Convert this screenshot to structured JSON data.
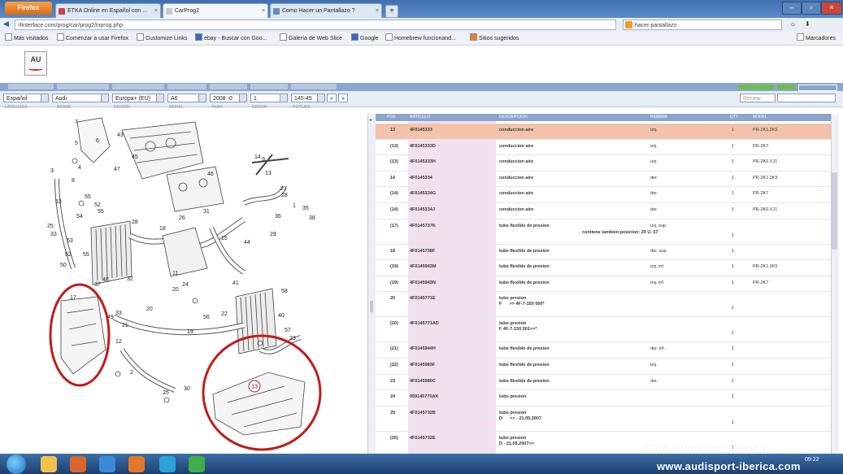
{
  "browser": {
    "firefox_button": "Firefox",
    "tabs": [
      {
        "label": "ETKA Online en Español con ..."
      },
      {
        "label": "CarProg2"
      },
      {
        "label": "Como Hacer un Pantallazo ?"
      }
    ],
    "url": "ifinterface.com/prog/car/prog2/inprog.php",
    "search": "hacer pantallazo",
    "bookmarks": [
      "Más visitados",
      "Comenzar a usar Firefox",
      "Customize Links",
      "ebay - Buscar con Goo...",
      "Galería de Web Slice",
      "Google",
      "Homebrew funcionand...",
      "Sitios sugeridos"
    ],
    "bookmarks_right": "Marcadores"
  },
  "app": {
    "logo_text": "AU",
    "selects": [
      {
        "value": "Español"
      },
      {
        "value": "Audi"
      },
      {
        "value": "Europa+ (EU)"
      },
      {
        "value": "A6"
      },
      {
        "value": "2008 -0"
      },
      {
        "value": "1"
      },
      {
        "value": "145-45"
      }
    ],
    "nav_prev": "«",
    "nav_next": "»",
    "right_field": "Renew",
    "labels": [
      "LANGUAGE",
      "BRAND",
      "REGION",
      "MODEL",
      "YEAR",
      "GROUP",
      "PICTURE"
    ]
  },
  "table": {
    "headers": [
      "POS",
      "ARTICULO",
      "DESCRIPCION",
      "REMARK",
      "QTY",
      "MODEL"
    ],
    "rows": [
      {
        "pos": "13",
        "art": "4F0145333",
        "desc": "conduccion aire",
        "rem": "izq.",
        "qty": "1",
        "model": "PR-2K1,2K5",
        "hl": true
      },
      {
        "pos": "(13)",
        "art": "4F0145333D",
        "desc": "conduccion aire",
        "rem": "izq.",
        "qty": "1",
        "model": "PR-2K7"
      },
      {
        "pos": "(13)",
        "art": "4F0145333H",
        "desc": "conduccion aire",
        "rem": "izq.",
        "qty": "1",
        "model": "PR-2K0,VJ1"
      },
      {
        "pos": "14",
        "art": "4F0145334",
        "desc": "conduccion aire",
        "rem": "der.",
        "qty": "1",
        "model": "PR-2K1,2K5"
      },
      {
        "pos": "(14)",
        "art": "4F0145334G",
        "desc": "conduccion aire",
        "rem": "der.",
        "qty": "1",
        "model": "PR-2K7"
      },
      {
        "pos": "(14)",
        "art": "4F0145334J",
        "desc": "conduccion aire",
        "rem": "der.",
        "qty": "1",
        "model": "PR-2K0,VJ1"
      },
      {
        "pos": "(17)",
        "art": "4F0145737K",
        "desc": "tubo flexible de presion",
        "rem": "izq. sup.",
        "qty": "1",
        "model": "",
        "note": "contiene tambien posicion: 20 U. 57"
      },
      {
        "pos": "18",
        "art": "4F0145738F",
        "desc": "tubo flexible de presion",
        "rem": "der. sup.",
        "qty": "1",
        "model": ""
      },
      {
        "pos": "(19)",
        "art": "4F0145943M",
        "desc": "tubo flexible de presion",
        "rem": "izq. inf.",
        "qty": "1",
        "model": "PR-2K1,2K5"
      },
      {
        "pos": "(19)",
        "art": "4F0145943N",
        "desc": "tubo flexible de presion",
        "rem": "izq. inf.",
        "qty": "1",
        "model": "PR-2K7"
      },
      {
        "pos": "20",
        "art": "4F0145771E",
        "desc": "tubo presion\nF      >> 4F-7-150 000*",
        "rem": "",
        "qty": "1",
        "model": ""
      },
      {
        "pos": "(20)",
        "art": "4F0145771AD",
        "desc": "tubo presion\nF 4F-7-150 001>>*",
        "rem": "",
        "qty": "1",
        "model": ""
      },
      {
        "pos": "(21)",
        "art": "4F0145944H",
        "desc": "tubo flexible de presion",
        "rem": "der. inf.",
        "qty": "1",
        "model": ""
      },
      {
        "pos": "(22)",
        "art": "4F0145983F",
        "desc": "tubo flexible de presion",
        "rem": "izq.",
        "qty": "1",
        "model": ""
      },
      {
        "pos": "23",
        "art": "4F0145980C",
        "desc": "tubo flexible de presion",
        "rem": "der.",
        "qty": "1",
        "model": ""
      },
      {
        "pos": "24",
        "art": "059145770AK",
        "desc": "tubo presion",
        "rem": "",
        "qty": "1",
        "model": ""
      },
      {
        "pos": "25",
        "art": "4F0145732B",
        "desc": "tubo presion\nD      >> - 21.05.2007",
        "rem": "",
        "qty": "1",
        "model": ""
      },
      {
        "pos": "(25)",
        "art": "4F0145732E",
        "desc": "tubo presion\nD - 21.05.2007>>",
        "rem": "",
        "qty": "1",
        "model": ""
      }
    ]
  },
  "diagram": {
    "labels": [
      "7",
      "5",
      "6",
      "4",
      "43",
      "47",
      "45",
      "46",
      "9",
      "13",
      "14",
      "8",
      "3",
      "55",
      "52",
      "53",
      "55",
      "54",
      "25",
      "28",
      "18",
      "26",
      "31",
      "28",
      "1",
      "33",
      "53",
      "52",
      "50",
      "48",
      "37",
      "32",
      "19",
      "20",
      "21",
      "33",
      "20",
      "17",
      "49",
      "12",
      "2",
      "22",
      "40",
      "24",
      "57",
      "23",
      "56",
      "41",
      "15",
      "44",
      "29",
      "11",
      "58",
      "25",
      "30",
      "55",
      "27",
      "35",
      "38",
      "36"
    ],
    "callout_label": "13"
  },
  "watermark": {
    "line1": "Club Audisport Iberica",
    "line2": "www.audisport-iberica.com"
  },
  "taskbar": {
    "clock": "09:22"
  }
}
